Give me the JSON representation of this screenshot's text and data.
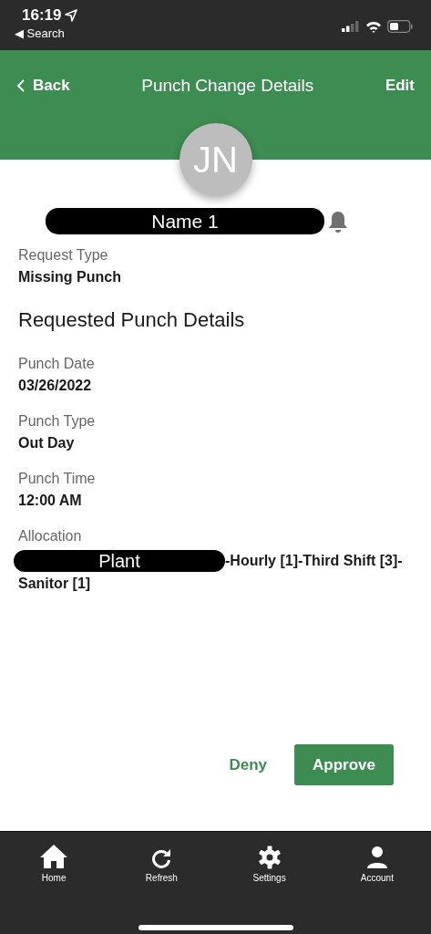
{
  "status_bar": {
    "time": "16:19",
    "back_label": "◀ Search"
  },
  "header": {
    "back": "Back",
    "title": "Punch Change Details",
    "action": "Edit"
  },
  "employee": {
    "initials": "JN",
    "name": "Name 1"
  },
  "request_type": {
    "label": "Request Type",
    "value": "Missing Punch"
  },
  "section_title": "Requested Punch Details",
  "fields": [
    {
      "label": "Punch Date",
      "value": "03/26/2022"
    },
    {
      "label": "Punch Type",
      "value": "Out Day"
    },
    {
      "label": "Punch Time",
      "value": "12:00 AM"
    }
  ],
  "allocation": {
    "label": "Allocation",
    "redacted": "Plant",
    "lines": [
      "-Hourly [1]-Third Shift [3]-",
      "Sanitor [1]"
    ]
  },
  "actions": {
    "deny": "Deny",
    "approve": "Approve"
  },
  "tab_bar": [
    {
      "kind": "home",
      "label": "Home"
    },
    {
      "kind": "refresh",
      "label": "Refresh"
    },
    {
      "kind": "settings",
      "label": "Settings"
    },
    {
      "kind": "account",
      "label": "Account"
    }
  ]
}
